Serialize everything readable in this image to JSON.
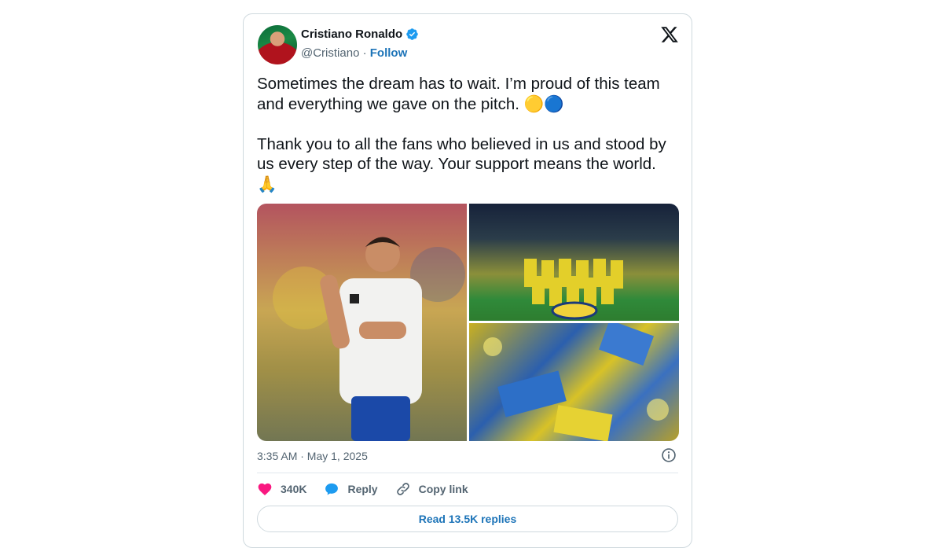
{
  "author": {
    "name": "Cristiano Ronaldo",
    "handle": "@Cristiano",
    "separator": "·",
    "follow_label": "Follow"
  },
  "tweet": {
    "text": "Sometimes the dream has to wait. I’m proud of this team and everything we gave on the pitch. 🟡🔵\n\nThank you to all the fans who believed in us and stood by us every step of the way. Your support means the world.\n🙏",
    "timestamp": "3:35 AM · May 1, 2025"
  },
  "engagement": {
    "likes": "340K",
    "reply_label": "Reply",
    "copy_link_label": "Copy link",
    "read_replies_label": "Read 13.5K replies"
  },
  "media": [
    {
      "description_icon": "player-applauding-photo"
    },
    {
      "description_icon": "team-photo"
    },
    {
      "description_icon": "fans-crowd-photo"
    }
  ],
  "colors": {
    "accent": "#1d74b8",
    "verified": "#1d9bf0",
    "like": "#f91880",
    "yellow_dot": "#f8c846",
    "blue_dot": "#55acee"
  }
}
